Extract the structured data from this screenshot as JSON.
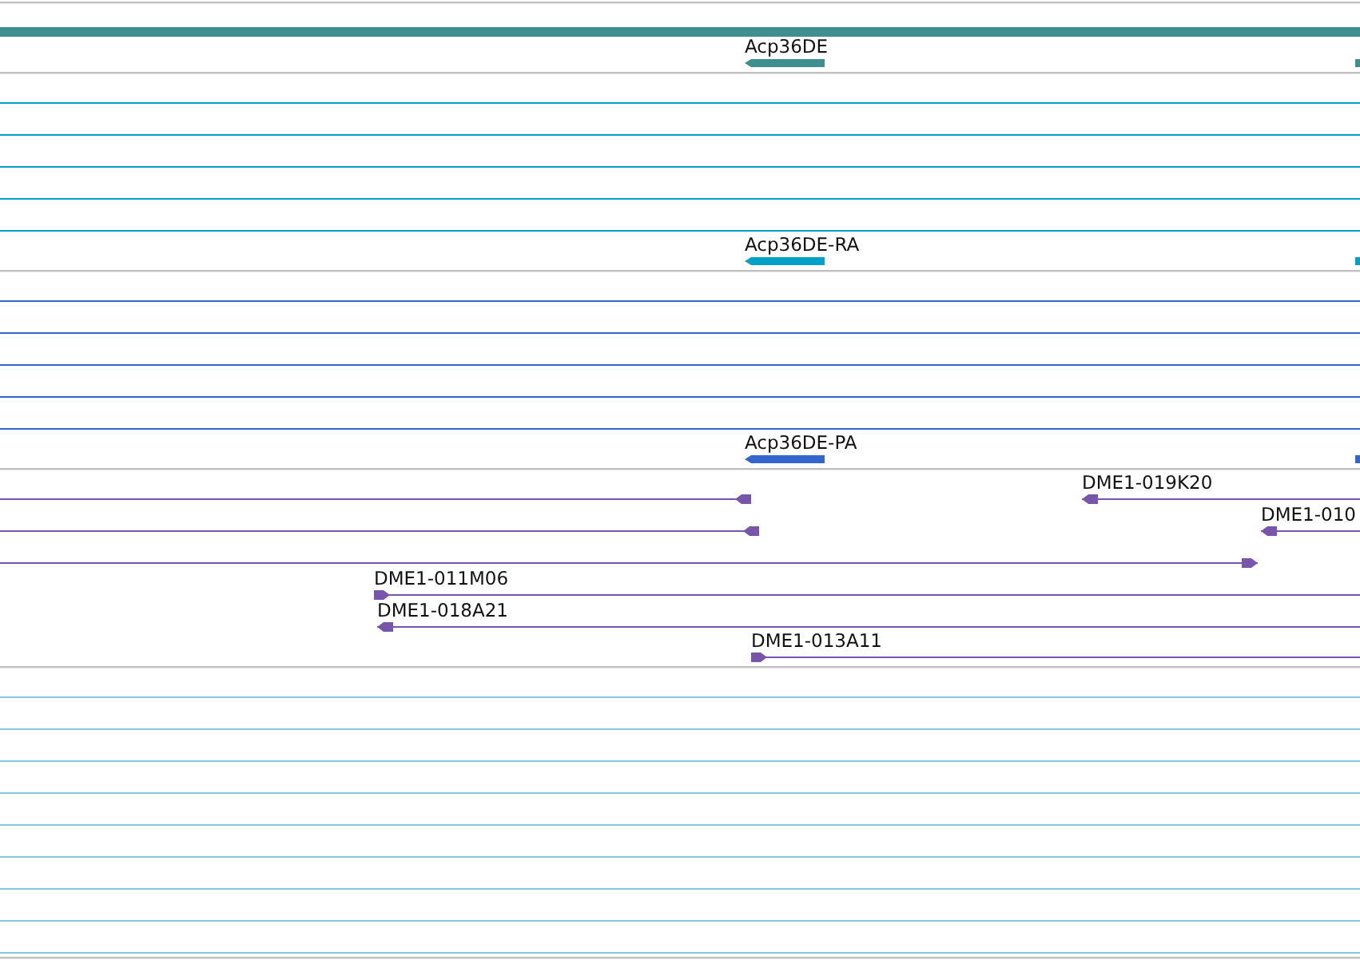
{
  "tracks": [
    {
      "kind": "gene",
      "color": "#3f8f90",
      "features": [
        {
          "label": "Acp36DE",
          "reverse": true
        },
        {
          "reverse": false
        }
      ]
    },
    {
      "kind": "transcript",
      "color": "#00a0c8",
      "features": [
        {
          "label": "Acp36DE-RA",
          "reverse": true
        },
        {
          "reverse": false
        }
      ]
    },
    {
      "kind": "protein",
      "color": "#3366cc",
      "features": [
        {
          "label": "Acp36DE-PA",
          "reverse": true
        },
        {
          "reverse": false
        }
      ]
    },
    {
      "kind": "clone",
      "color": "#7755aa",
      "features": [
        {
          "reverse": true
        },
        {
          "label": "DME1-019K20",
          "reverse": true
        },
        {
          "reverse": true
        },
        {
          "label": "DME1-010",
          "reverse": true
        },
        {
          "reverse": false
        },
        {
          "label": "DME1-011M06",
          "reverse": false
        },
        {
          "label": "DME1-018A21",
          "reverse": true
        },
        {
          "label": "DME1-013A11",
          "reverse": false
        }
      ]
    },
    {
      "kind": "empty",
      "color": "#88c4e4"
    }
  ]
}
